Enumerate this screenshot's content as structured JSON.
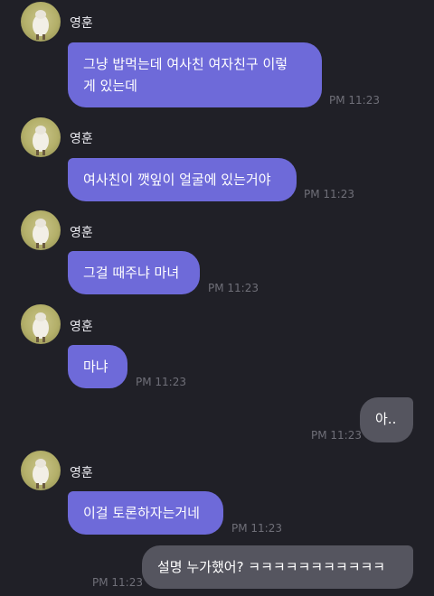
{
  "messages": [
    {
      "sender": "영훈",
      "text": "그냥 밥먹는데 여사친 여자친구 이렇게 있는데",
      "line1": "그냥 밥먹는데 여사친 여자친구 이렇",
      "line2": "게 있는데",
      "time": "PM 11:23"
    },
    {
      "sender": "영훈",
      "text": "여사친이 깻잎이 얼굴에 있는거야",
      "time": "PM 11:23"
    },
    {
      "sender": "영훈",
      "text": "그걸 때주냐 마녀",
      "time": "PM 11:23"
    },
    {
      "sender": "영훈",
      "text": "마냐",
      "time": "PM 11:23"
    },
    {
      "sender": "me",
      "text": "아..",
      "time": "PM 11:23"
    },
    {
      "sender": "영훈",
      "text": "이걸 토론하자는거네",
      "time": "PM 11:23"
    },
    {
      "sender": "me",
      "text": "설명 누가했어? ㅋㅋㅋㅋㅋㅋㅋㅋㅋㅋㅋ",
      "time": "PM 11:23"
    }
  ],
  "avatar_icon": "sheep-photo",
  "colors": {
    "background": "#202027",
    "incoming_bubble": "#6e6ad9",
    "outgoing_bubble": "#55555f",
    "timestamp": "#6f6f78"
  }
}
